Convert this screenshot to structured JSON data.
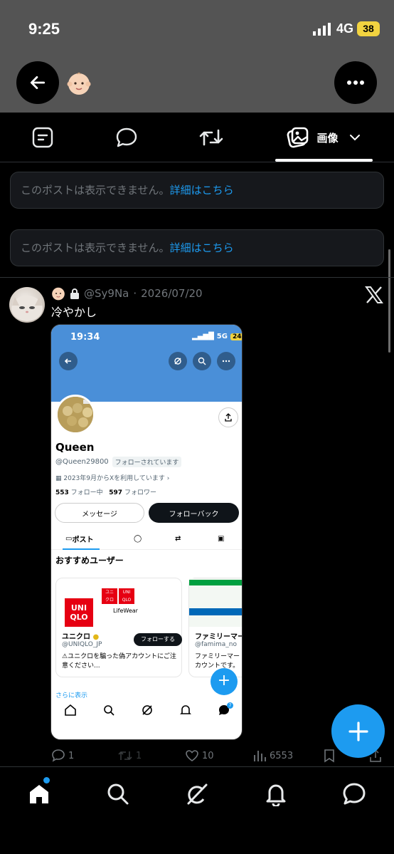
{
  "status_bar": {
    "time": "9:25",
    "network": "4G",
    "battery": "38"
  },
  "header": {
    "back_icon": "arrow-left-icon",
    "emoji_icon": "baby-face-icon",
    "more_icon": "ellipsis-icon"
  },
  "tabs": [
    {
      "icon": "post-icon",
      "label": ""
    },
    {
      "icon": "reply-icon",
      "label": ""
    },
    {
      "icon": "repost-icon",
      "label": ""
    },
    {
      "icon": "media-icon",
      "label": "画像",
      "selected": true
    }
  ],
  "notices": [
    {
      "text": "このポストは表示できません。",
      "link": "詳細はこちら"
    },
    {
      "text": "このポストは表示できません。",
      "link": "詳細はこちら"
    }
  ],
  "post": {
    "handle": "@Sy9Na",
    "separator": "·",
    "date": "2026/07/20",
    "text": "冷やかし",
    "stats": {
      "replies": "1",
      "reposts": "1",
      "likes": "10",
      "views": "6553"
    },
    "embedded_screenshot": {
      "time": "19:34",
      "network": "5G",
      "battery": "24",
      "name": "Queen",
      "handle": "@Queen29800",
      "followed_label": "フォローされています",
      "joined": "2023年9月からXを利用しています",
      "following_count": "553",
      "following_label": "フォロー中",
      "followers_count": "597",
      "followers_label": "フォロワー",
      "message_button": "メッセージ",
      "followback_button": "フォローバック",
      "tab_posts": "ポスト",
      "recommend_title": "おすすめユーザー",
      "card1": {
        "logo_text": "UNI QLO",
        "sub_logo": "LifeWear",
        "name": "ユニクロ",
        "handle": "@UNIQLO_JP",
        "follow": "フォローする",
        "desc": "⚠ユニクロを騙った偽アカウントにご注意ください..."
      },
      "card2": {
        "name": "ファミリーマー",
        "handle": "@famima_no",
        "desc": "ファミリーマーカウントです。"
      },
      "show_more": "さらに表示",
      "badge": "7"
    }
  },
  "colors": {
    "accent": "#1d9bf0",
    "background": "#000000",
    "header_bg": "#545454",
    "muted": "#71767b"
  }
}
